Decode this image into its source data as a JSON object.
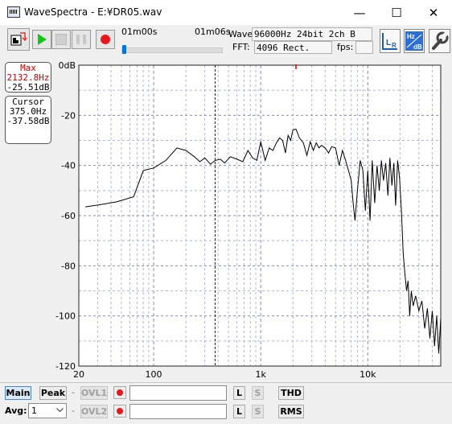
{
  "window": {
    "title": "WaveSpectra - E:¥DR05.wav",
    "min_glyph": "—",
    "max_glyph": "☐",
    "close_glyph": "✕"
  },
  "transport": {
    "time_start": "01m00s",
    "time_end": "01m06s",
    "position_fraction": 0.0
  },
  "wave": {
    "label": "Wave:",
    "value": "96000Hz 24bit 2ch B"
  },
  "fft": {
    "label": "FFT:",
    "value": "4096 Rect.",
    "fps_label": "fps:",
    "fps_value": ""
  },
  "buttons": {
    "lr_label": "LR",
    "hz_db_label": "Hz dB"
  },
  "max_box": {
    "title": "Max",
    "freq": "2132.8Hz",
    "level": "-25.51dB"
  },
  "cursor_box": {
    "title": "Cursor",
    "freq": "375.0Hz",
    "level": "-37.58dB"
  },
  "chart_data": {
    "type": "line",
    "x_scale": "log",
    "xlim": [
      20,
      48000
    ],
    "ylim": [
      -120,
      0
    ],
    "y_ticks": [
      0,
      -20,
      -40,
      -60,
      -80,
      -100,
      -120
    ],
    "y_tick_labels": [
      "0dB",
      "-20",
      "-40",
      "-60",
      "-80",
      "-100",
      "-120"
    ],
    "x_ticks": [
      20,
      100,
      1000,
      10000
    ],
    "x_tick_labels": [
      "20",
      "100",
      "1k",
      "10k"
    ],
    "cursor_x": 375,
    "peak_x": 2132.8,
    "grid": true,
    "series": [
      {
        "color": "#000000",
        "x": [
          23,
          30,
          45,
          65,
          80,
          100,
          130,
          165,
          200,
          240,
          270,
          300,
          340,
          375,
          420,
          460,
          520,
          600,
          680,
          760,
          840,
          920,
          1000,
          1100,
          1200,
          1300,
          1400,
          1500,
          1600,
          1700,
          1800,
          1900,
          2000,
          2132.8,
          2300,
          2500,
          2700,
          2900,
          3100,
          3300,
          3500,
          3700,
          4000,
          4300,
          4600,
          5000,
          5400,
          5800,
          6200,
          6600,
          7000,
          7300,
          7600,
          8000,
          8500,
          9000,
          9500,
          10000,
          10500,
          11000,
          11600,
          12200,
          12800,
          13400,
          14000,
          14700,
          15400,
          16100,
          16800,
          17500,
          18200,
          19000,
          19800,
          20600,
          21400,
          22200,
          23000,
          23800,
          24600,
          25500,
          26500,
          28000,
          30000,
          32000,
          34000,
          36000,
          38000,
          40000,
          42000,
          44000,
          46000,
          48000
        ],
        "y": [
          -56.5,
          -55.8,
          -54.5,
          -52.5,
          -42,
          -41,
          -38,
          -33,
          -34,
          -36.5,
          -38.5,
          -37,
          -39.5,
          -38,
          -37.5,
          -39,
          -36.5,
          -37.5,
          -38.5,
          -34,
          -37,
          -38,
          -30.5,
          -38,
          -33,
          -34,
          -31,
          -29,
          -30,
          -35,
          -28,
          -30,
          -25.8,
          -25.51,
          -29,
          -31,
          -36,
          -30.5,
          -34,
          -31,
          -33,
          -32,
          -33,
          -35,
          -32.5,
          -33,
          -40,
          -34,
          -38,
          -42,
          -46,
          -55,
          -62,
          -50,
          -38,
          -42,
          -58,
          -42,
          -62,
          -38,
          -55,
          -40,
          -50,
          -38,
          -46,
          -39,
          -52,
          -37,
          -48,
          -39,
          -56,
          -38,
          -45,
          -58,
          -75,
          -83,
          -90,
          -86,
          -100,
          -90,
          -96,
          -92,
          -98,
          -94,
          -105,
          -97,
          -109,
          -98,
          -112,
          -100,
          -115,
          -101
        ]
      }
    ]
  },
  "bottom": {
    "main": "Main",
    "peak": "Peak",
    "ovl1": "OVL1",
    "ovl2": "OVL2",
    "l1": "L",
    "s1": "S",
    "l2": "L",
    "s2": "S",
    "thd": "THD",
    "rms": "RMS",
    "avg_label": "Avg:",
    "avg_value": "1",
    "dash": "-"
  }
}
